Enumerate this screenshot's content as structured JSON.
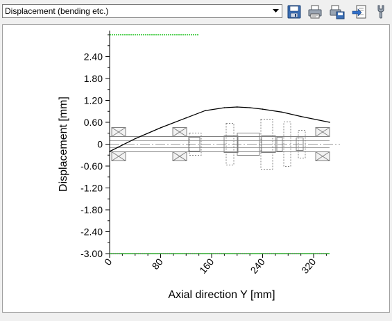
{
  "toolbar": {
    "dropdown_value": "Displacement (bending etc.)",
    "buttons": [
      {
        "name": "save-button",
        "icon": "floppy-disk-icon"
      },
      {
        "name": "print-button",
        "icon": "printer-icon"
      },
      {
        "name": "print-preview-button",
        "icon": "print-settings-icon"
      },
      {
        "name": "export-button",
        "icon": "export-arrow-icon"
      },
      {
        "name": "settings-button",
        "icon": "wrench-icon"
      }
    ]
  },
  "chart_data": {
    "type": "line",
    "xlabel": "Axial direction Y [mm]",
    "ylabel": "Displacement [mm]",
    "xlim": [
      0,
      345
    ],
    "ylim": [
      -3.0,
      3.0
    ],
    "xticks": [
      0,
      80,
      160,
      240,
      320
    ],
    "xtick_labels": [
      "0",
      "80",
      "160",
      "240",
      "320"
    ],
    "yticks": [
      2.4,
      1.8,
      1.2,
      0.6,
      0,
      -0.6,
      -1.2,
      -1.8,
      -2.4,
      -3.0
    ],
    "ytick_labels": [
      "2.40",
      "1.80",
      "1.20",
      "0.60",
      "0",
      "-0.60",
      "-1.20",
      "-1.80",
      "-2.40",
      "-3.00"
    ],
    "series": [
      {
        "color": "#000000",
        "x": [
          0,
          40,
          80,
          120,
          150,
          180,
          200,
          220,
          240,
          270,
          300,
          345
        ],
        "y": [
          -0.2,
          0.15,
          0.45,
          0.72,
          0.92,
          1.0,
          1.02,
          1.0,
          0.96,
          0.88,
          0.76,
          0.6
        ]
      }
    ],
    "limit_lines": {
      "color": "#22c322",
      "upper": {
        "y": 3.0,
        "x": [
          0,
          140
        ]
      },
      "lower": {
        "y": -3.0,
        "x": [
          0,
          345
        ]
      }
    },
    "shaft_color": "#808080"
  }
}
